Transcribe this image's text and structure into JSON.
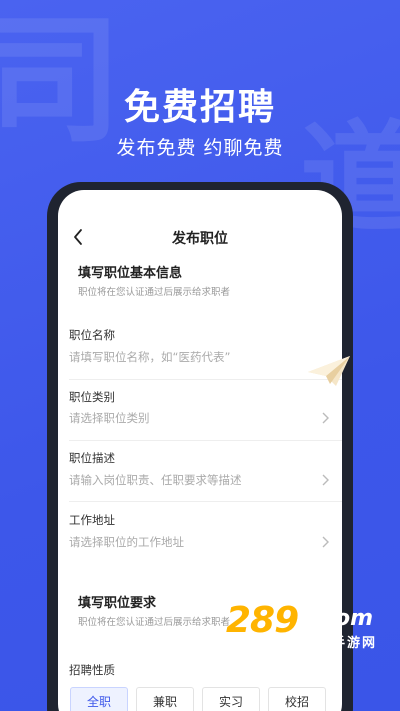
{
  "hero": {
    "title": "免费招聘",
    "subtitle": "发布免费  约聊免费"
  },
  "nav": {
    "title": "发布职位"
  },
  "basic_section": {
    "title": "填写职位基本信息",
    "hint": "职位将在您认证通过后展示给求职者"
  },
  "fields": [
    {
      "label": "职位名称",
      "placeholder": "请填写职位名称，如“医药代表”"
    },
    {
      "label": "职位类别",
      "placeholder": "请选择职位类别"
    },
    {
      "label": "职位描述",
      "placeholder": "请输入岗位职责、任职要求等描述"
    },
    {
      "label": "工作地址",
      "placeholder": "请选择职位的工作地址"
    }
  ],
  "req_section": {
    "title": "填写职位要求",
    "hint": "职位将在您认证通过后展示给求职者"
  },
  "job_nature": {
    "label": "招聘性质",
    "options": [
      "全职",
      "兼职",
      "实习",
      "校招"
    ],
    "selected": "全职"
  },
  "watermark": {
    "number": "289",
    "suffix": "com",
    "subtitle": "手游网"
  },
  "colors": {
    "brand": "#3d57ea",
    "phone_frame": "#1f2430",
    "watermark_orange": "#ffb400"
  },
  "icons": {
    "back": "chevron-left-icon",
    "disclosure": "chevron-right-icon",
    "decor": "paper-plane-icon"
  }
}
